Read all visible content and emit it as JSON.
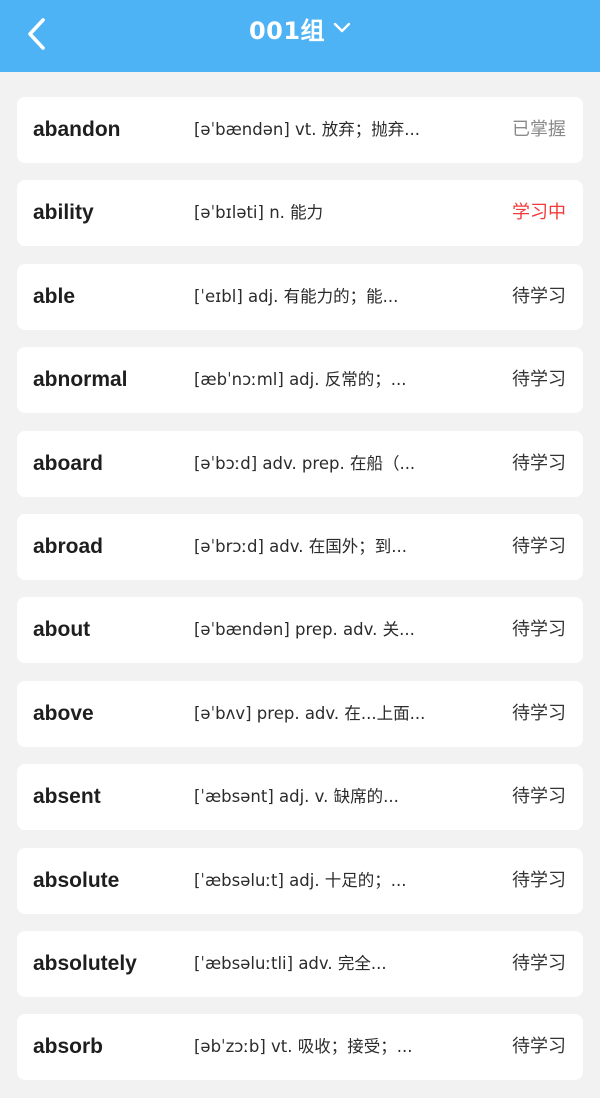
{
  "header": {
    "title": "001组",
    "back_icon": "chevron-left-icon",
    "dropdown_icon": "chevron-down-icon",
    "bg_color": "#4db3f5"
  },
  "status_colors": {
    "mastered": "#8a8a8a",
    "learning": "#f23a3a",
    "pending": "#333333"
  },
  "words": [
    {
      "word": "abandon",
      "definition": "[əˈbændən] vt. 放弃；抛弃...",
      "status": "已掌握",
      "state": "mastered"
    },
    {
      "word": "ability",
      "definition": "[əˈbɪləti] n. 能力",
      "status": "学习中",
      "state": "learning"
    },
    {
      "word": "able",
      "definition": "[ˈeɪbl] adj. 有能力的；能...",
      "status": "待学习",
      "state": "pending"
    },
    {
      "word": "abnormal",
      "definition": "[æbˈnɔːml] adj. 反常的；...",
      "status": "待学习",
      "state": "pending"
    },
    {
      "word": "aboard",
      "definition": "[əˈbɔːd] adv.  prep. 在船（...",
      "status": "待学习",
      "state": "pending"
    },
    {
      "word": "abroad",
      "definition": "[əˈbrɔːd] adv. 在国外；到...",
      "status": "待学习",
      "state": "pending"
    },
    {
      "word": "about",
      "definition": "[əˈbændən] prep. adv. 关...",
      "status": "待学习",
      "state": "pending"
    },
    {
      "word": "above",
      "definition": "[əˈbʌv] prep. adv. 在...上面...",
      "status": "待学习",
      "state": "pending"
    },
    {
      "word": "absent",
      "definition": "[ˈæbsənt] adj.  v.  缺席的...",
      "status": "待学习",
      "state": "pending"
    },
    {
      "word": "absolute",
      "definition": "[ˈæbsəluːt] adj. 十足的；...",
      "status": "待学习",
      "state": "pending"
    },
    {
      "word": "absolutely",
      "definition": "[ˈæbsəluːtli] adv.  完全...",
      "status": "待学习",
      "state": "pending"
    },
    {
      "word": "absorb",
      "definition": "[əbˈzɔːb] vt. 吸收；接受；...",
      "status": "待学习",
      "state": "pending"
    }
  ]
}
